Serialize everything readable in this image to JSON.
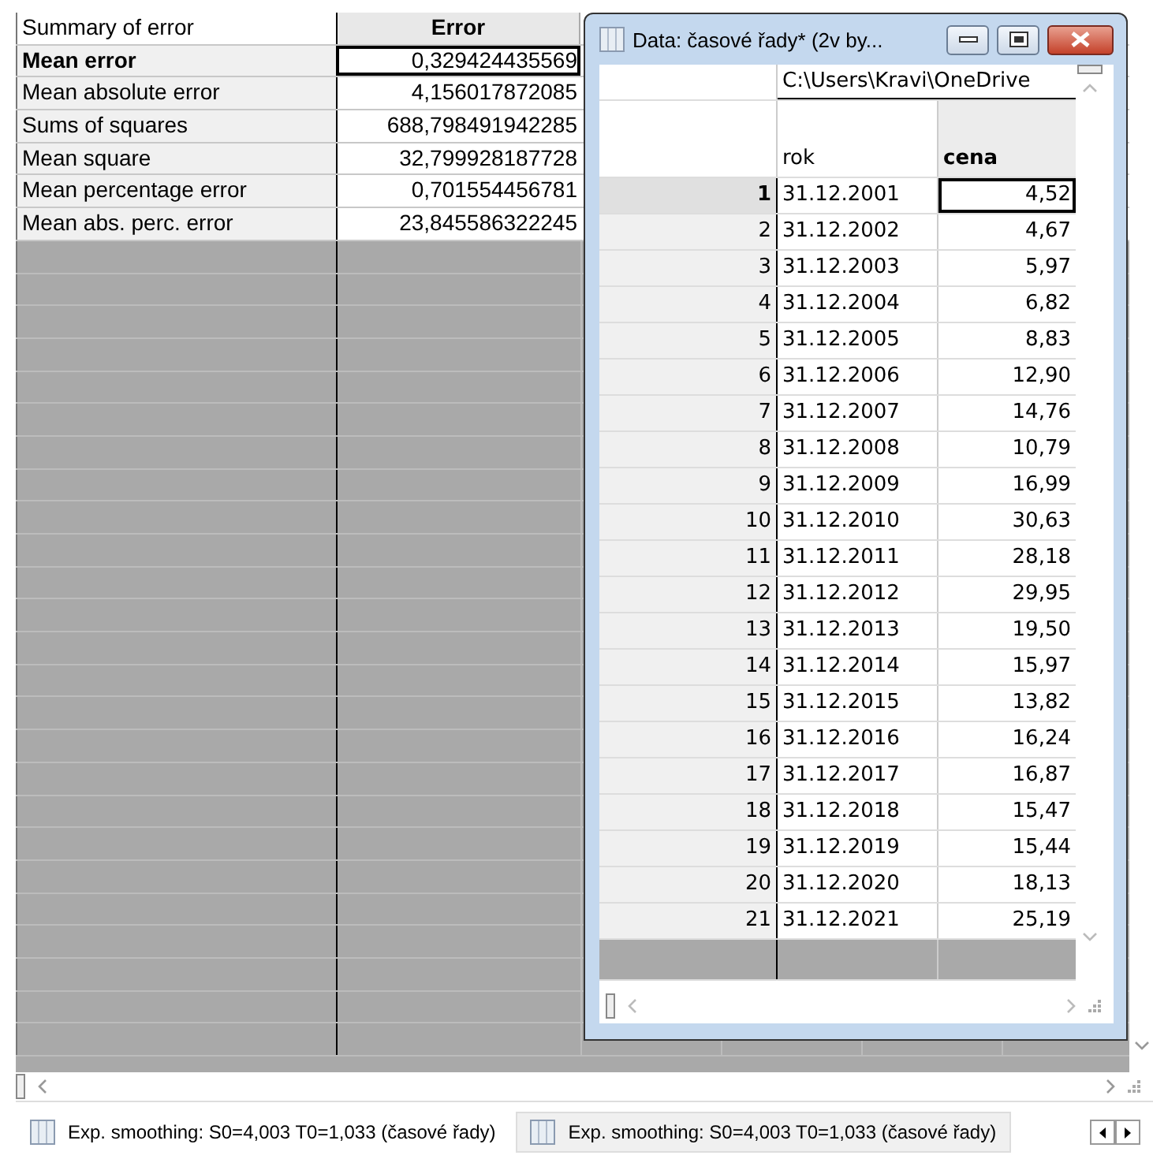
{
  "summary": {
    "header_label": "Summary of error",
    "column": "Error",
    "rows": [
      {
        "label": "Mean error",
        "value": "0,329424435569",
        "selected": true
      },
      {
        "label": "Mean absolute error",
        "value": "4,156017872085",
        "selected": false
      },
      {
        "label": "Sums of squares",
        "value": "688,798491942285",
        "selected": false
      },
      {
        "label": "Mean square",
        "value": "32,799928187728",
        "selected": false
      },
      {
        "label": "Mean percentage error",
        "value": "0,701554456781",
        "selected": false
      },
      {
        "label": "Mean abs. perc. error",
        "value": "23,845586322245",
        "selected": false
      }
    ]
  },
  "data_window": {
    "title": "Data: časové řady* (2v by...",
    "path": "C:\\Users\\Kravi\\OneDrive",
    "columns": [
      "rok",
      "cena"
    ],
    "rows": [
      {
        "index": "1",
        "rok": "31.12.2001",
        "cena": "4,52",
        "selected": true
      },
      {
        "index": "2",
        "rok": "31.12.2002",
        "cena": "4,67",
        "selected": false
      },
      {
        "index": "3",
        "rok": "31.12.2003",
        "cena": "5,97",
        "selected": false
      },
      {
        "index": "4",
        "rok": "31.12.2004",
        "cena": "6,82",
        "selected": false
      },
      {
        "index": "5",
        "rok": "31.12.2005",
        "cena": "8,83",
        "selected": false
      },
      {
        "index": "6",
        "rok": "31.12.2006",
        "cena": "12,90",
        "selected": false
      },
      {
        "index": "7",
        "rok": "31.12.2007",
        "cena": "14,76",
        "selected": false
      },
      {
        "index": "8",
        "rok": "31.12.2008",
        "cena": "10,79",
        "selected": false
      },
      {
        "index": "9",
        "rok": "31.12.2009",
        "cena": "16,99",
        "selected": false
      },
      {
        "index": "10",
        "rok": "31.12.2010",
        "cena": "30,63",
        "selected": false
      },
      {
        "index": "11",
        "rok": "31.12.2011",
        "cena": "28,18",
        "selected": false
      },
      {
        "index": "12",
        "rok": "31.12.2012",
        "cena": "29,95",
        "selected": false
      },
      {
        "index": "13",
        "rok": "31.12.2013",
        "cena": "19,50",
        "selected": false
      },
      {
        "index": "14",
        "rok": "31.12.2014",
        "cena": "15,97",
        "selected": false
      },
      {
        "index": "15",
        "rok": "31.12.2015",
        "cena": "13,82",
        "selected": false
      },
      {
        "index": "16",
        "rok": "31.12.2016",
        "cena": "16,24",
        "selected": false
      },
      {
        "index": "17",
        "rok": "31.12.2017",
        "cena": "16,87",
        "selected": false
      },
      {
        "index": "18",
        "rok": "31.12.2018",
        "cena": "15,47",
        "selected": false
      },
      {
        "index": "19",
        "rok": "31.12.2019",
        "cena": "15,44",
        "selected": false
      },
      {
        "index": "20",
        "rok": "31.12.2020",
        "cena": "18,13",
        "selected": false
      },
      {
        "index": "21",
        "rok": "31.12.2021",
        "cena": "25,19",
        "selected": false
      }
    ]
  },
  "tabs": [
    {
      "label": "Exp. smoothing: S0=4,003 T0=1,033 (časové řady)",
      "selected": true
    },
    {
      "label": "Exp. smoothing: S0=4,003 T0=1,033 (časové řady)",
      "selected": false
    }
  ]
}
